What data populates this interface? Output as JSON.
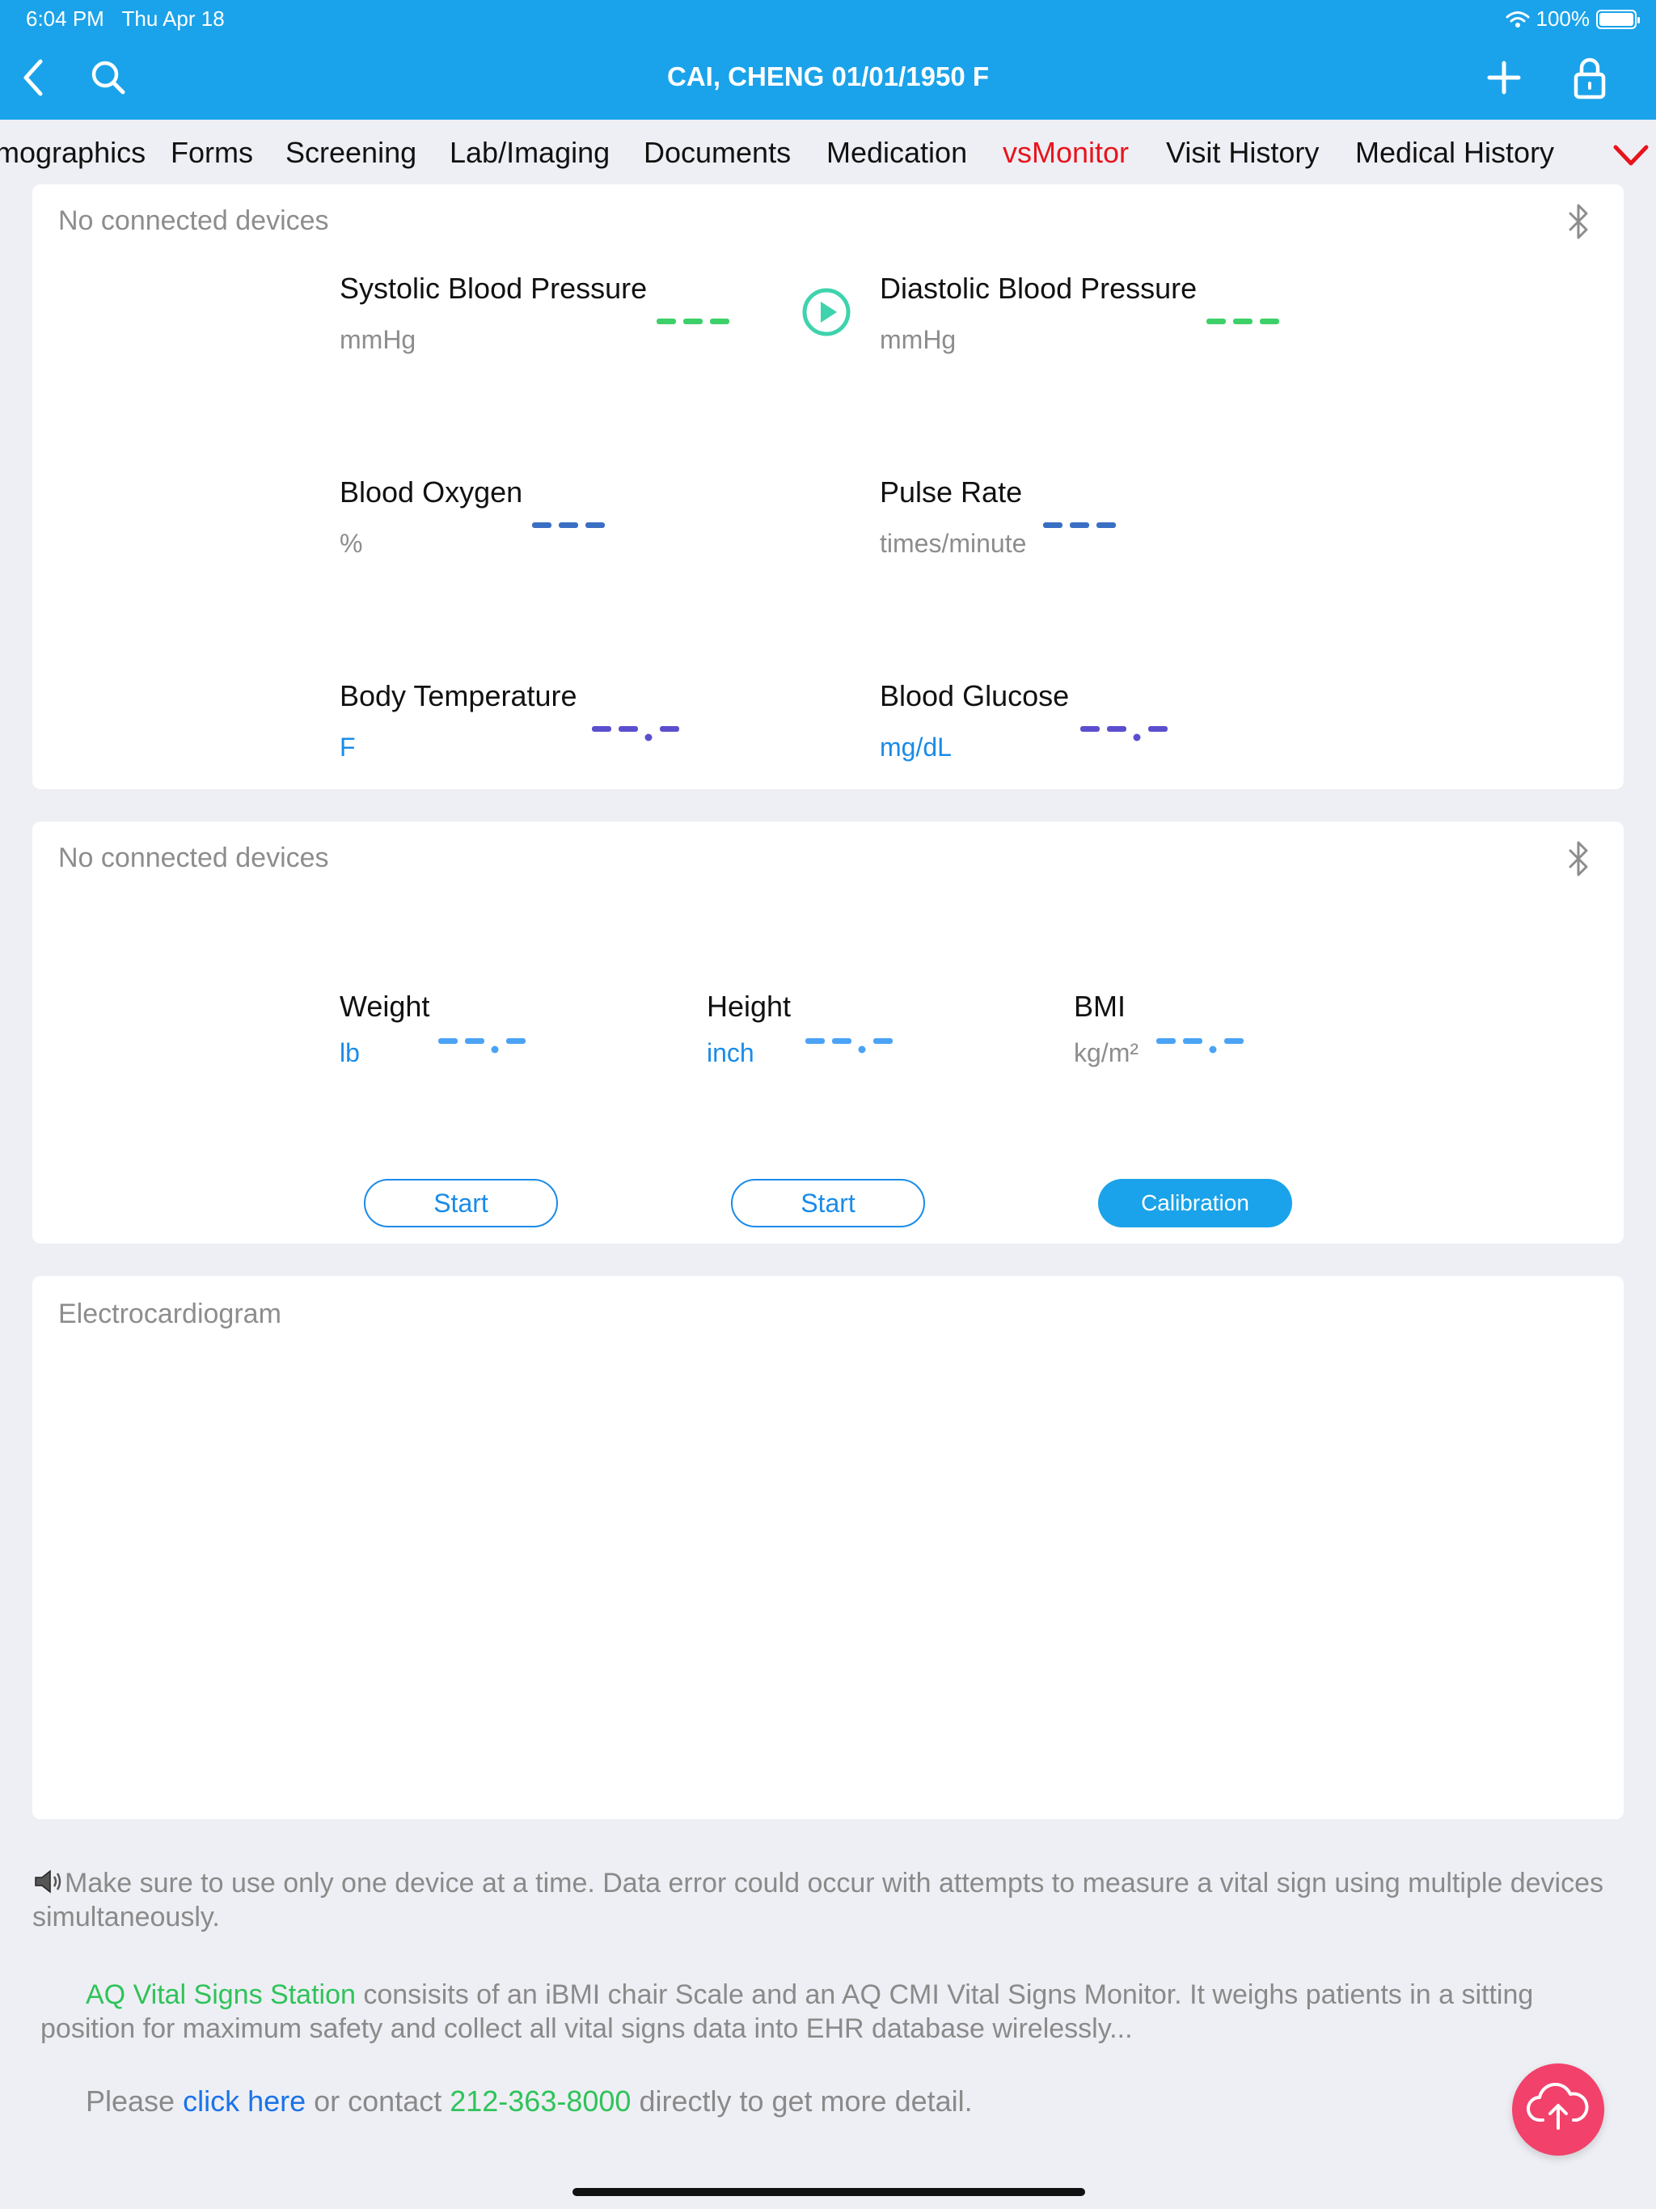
{
  "status_bar": {
    "time": "6:04 PM",
    "date": "Thu Apr 18",
    "battery": "100%"
  },
  "header": {
    "patient": "CAI, CHENG 01/01/1950 F"
  },
  "tabs": [
    {
      "label": "mographics"
    },
    {
      "label": "Forms"
    },
    {
      "label": "Screening"
    },
    {
      "label": "Lab/Imaging"
    },
    {
      "label": "Documents"
    },
    {
      "label": "Medication"
    },
    {
      "label": "vsMonitor",
      "active": true
    },
    {
      "label": "Visit History"
    },
    {
      "label": "Medical History"
    }
  ],
  "vitals_card": {
    "status": "No connected devices",
    "systolic": {
      "label": "Systolic Blood Pressure",
      "unit": "mmHg"
    },
    "diastolic": {
      "label": "Diastolic Blood Pressure",
      "unit": "mmHg"
    },
    "oxygen": {
      "label": "Blood Oxygen",
      "unit": "%"
    },
    "pulse": {
      "label": "Pulse Rate",
      "unit": "times/minute"
    },
    "temperature": {
      "label": "Body Temperature",
      "unit": "F"
    },
    "glucose": {
      "label": "Blood Glucose",
      "unit": "mg/dL"
    }
  },
  "body_card": {
    "status": "No connected devices",
    "weight": {
      "label": "Weight",
      "unit": "lb"
    },
    "height": {
      "label": "Height",
      "unit": "inch"
    },
    "bmi": {
      "label": "BMI",
      "unit": "kg/m²"
    },
    "weight_button": "Start",
    "height_button": "Start",
    "calibration_button": "Calibration"
  },
  "ecg_card": {
    "title": "Electrocardiogram"
  },
  "footer": {
    "note": "Make sure to use only one device at a time. Data error could occur with attempts to measure a vital sign using multiple devices simultaneously.",
    "station_name": "AQ Vital Signs Station",
    "station_desc": " consisits of an iBMI chair Scale and an AQ CMI Vital Signs Monitor. It weighs patients in a sitting position for maximum safety and collect all vital signs data into EHR database wirelessly...",
    "contact_prefix": "Please ",
    "contact_link": "click here",
    "contact_mid": " or contact ",
    "contact_phone": "212-363-8000",
    "contact_suffix": " directly to get more detail."
  },
  "colors": {
    "header_bg": "#1aa3ea",
    "active_tab": "#e8141c",
    "bp_dash": "#3dd068",
    "oxy_dash": "#3a6fc4",
    "temp_dash": "#5b4fcf",
    "body_dash": "#4aa3f5",
    "fab": "#f2416a"
  }
}
